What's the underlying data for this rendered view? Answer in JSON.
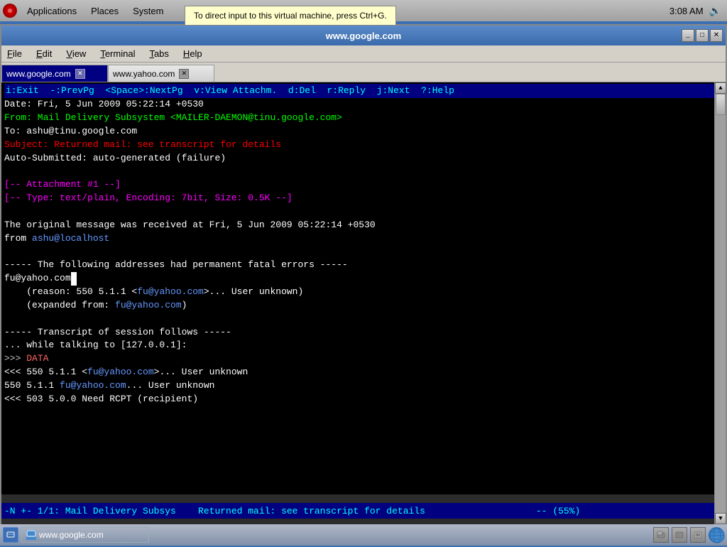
{
  "topbar": {
    "logo": "●",
    "menu_items": [
      "Applications",
      "Places",
      "System"
    ],
    "time": "3:08 AM",
    "tooltip": "To direct input to this virtual machine, press Ctrl+G."
  },
  "terminal": {
    "title": "www.google.com",
    "tabs": [
      {
        "label": "www.google.com",
        "active": true
      },
      {
        "label": "www.yahoo.com",
        "active": false
      }
    ],
    "menus": [
      "File",
      "Edit",
      "View",
      "Terminal",
      "Tabs",
      "Help"
    ],
    "status_line": "i:Exit  -:PrevPg  <Space>:NextPg  v:View Attachm.  d:Del  r:Reply  j:Next  ?:Help",
    "email": {
      "date": "Date: Fri, 5 Jun 2009 05:22:14 +0530",
      "from": "From: Mail Delivery Subsystem <MAILER-DAEMON@tinu.google.com>",
      "to": "To: ashu@tinu.google.com",
      "subject": "Subject: Returned mail: see transcript for details",
      "auto_submitted": "Auto-Submitted: auto-generated (failure)",
      "blank1": "",
      "attachment1": "[-- Attachment #1 --]",
      "attachment2": "[-- Type: text/plain, Encoding: 7bit, Size: 0.5K --]",
      "blank2": "",
      "original1": "The original message was received at Fri, 5 Jun 2009 05:22:14 +0530",
      "original2": "from ashu@localhost",
      "blank3": "",
      "fatal": "----- The following addresses had permanent fatal errors -----",
      "fu_address": "fu@yahoo.com",
      "reason": "    (reason: 550 5.1.1 <fu@yahoo.com>... User unknown)",
      "expanded": "    (expanded from: fu@yahoo.com)",
      "blank4": "",
      "transcript": "----- Transcript of session follows -----",
      "talking": "... while talking to [127.0.0.1]:",
      "data_cmd": ">>> DATA",
      "resp1": "<<< 550 5.1.1 <fu@yahoo.com>... User unknown",
      "resp2": "550 5.1.1 fu@yahoo.com... User unknown",
      "resp3": "<<< 503 5.0.0 Need RCPT (recipient)"
    },
    "bottom_status": "-N +- 1/1: Mail Delivery Subsys    Returned mail: see transcript for details                    -- (55%)"
  },
  "taskbar": {
    "window_label": "www.google.com"
  }
}
